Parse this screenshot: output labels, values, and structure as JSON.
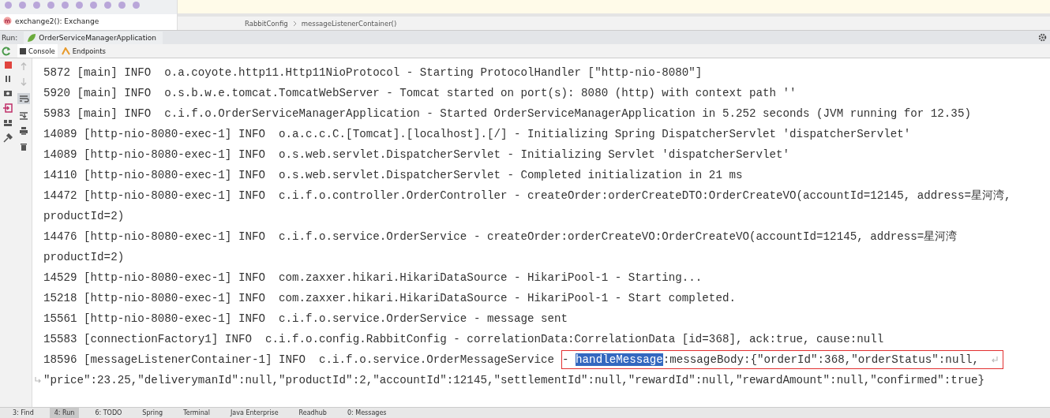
{
  "structure": {
    "item": "exchange2(): Exchange"
  },
  "breadcrumb": [
    "RabbitConfig",
    "messageListenerContainer()"
  ],
  "run_bar": {
    "label": "Run:",
    "tab": "OrderServiceManagerApplication"
  },
  "console_tabs": [
    {
      "label": "Console",
      "selected": true
    },
    {
      "label": "Endpoints",
      "selected": false
    }
  ],
  "log_lines": [
    {
      "kind": "plain",
      "text": "5872 [main] INFO  o.a.coyote.http11.Http11NioProtocol - Starting ProtocolHandler [\"http-nio-8080\"]"
    },
    {
      "kind": "plain",
      "text": "5920 [main] INFO  o.s.b.w.e.tomcat.TomcatWebServer - Tomcat started on port(s): 8080 (http) with context path ''"
    },
    {
      "kind": "plain",
      "text": "5983 [main] INFO  c.i.f.o.OrderServiceManagerApplication - Started OrderServiceManagerApplication in 5.252 seconds (JVM running for 12.35)"
    },
    {
      "kind": "plain",
      "text": "14089 [http-nio-8080-exec-1] INFO  o.a.c.c.C.[Tomcat].[localhost].[/] - Initializing Spring DispatcherServlet 'dispatcherServlet'"
    },
    {
      "kind": "plain",
      "text": "14089 [http-nio-8080-exec-1] INFO  o.s.web.servlet.DispatcherServlet - Initializing Servlet 'dispatcherServlet'"
    },
    {
      "kind": "plain",
      "text": "14110 [http-nio-8080-exec-1] INFO  o.s.web.servlet.DispatcherServlet - Completed initialization in 21 ms"
    },
    {
      "kind": "plain",
      "text": "14472 [http-nio-8080-exec-1] INFO  c.i.f.o.controller.OrderController - createOrder:orderCreateDTO:OrderCreateVO(accountId=12145, address=星河湾,",
      "continuation": "productId=2)"
    },
    {
      "kind": "plain",
      "text": "14476 [http-nio-8080-exec-1] INFO  c.i.f.o.service.OrderService - createOrder:orderCreateVO:OrderCreateVO(accountId=12145, address=星河湾",
      "continuation": "productId=2)"
    },
    {
      "kind": "plain",
      "text": "14529 [http-nio-8080-exec-1] INFO  com.zaxxer.hikari.HikariDataSource - HikariPool-1 - Starting..."
    },
    {
      "kind": "plain",
      "text": "15218 [http-nio-8080-exec-1] INFO  com.zaxxer.hikari.HikariDataSource - HikariPool-1 - Start completed."
    },
    {
      "kind": "plain",
      "text": "15561 [http-nio-8080-exec-1] INFO  c.i.f.o.service.OrderService - message sent"
    },
    {
      "kind": "plain",
      "text": "15583 [connectionFactory1] INFO  c.i.f.o.config.RabbitConfig - correlationData:CorrelationData [id=368], ack:true, cause:null"
    },
    {
      "kind": "highlighted",
      "text": "18596 [messageListenerContainer-1] INFO  c.i.f.o.service.OrderMessageService",
      "boxed": "- ",
      "selected": "handleMessage",
      "rest": ":messageBody:{\"orderId\":368,\"orderStatus\":null,",
      "continuation": "\"price\":23.25,\"deliverymanId\":null,\"productId\":2,\"accountId\":12145,\"settlementId\":null,\"rewardId\":null,\"rewardAmount\":null,\"confirmed\":true}"
    }
  ],
  "bottom_tools": [
    {
      "label": "3: Find",
      "selected": false
    },
    {
      "label": "4: Run",
      "selected": true
    },
    {
      "label": "6: TODO",
      "selected": false
    },
    {
      "label": "Spring",
      "selected": false
    },
    {
      "label": "Terminal",
      "selected": false
    },
    {
      "label": "Java Enterprise",
      "selected": false
    },
    {
      "label": "Readhub",
      "selected": false
    },
    {
      "label": "0: Messages",
      "selected": false
    }
  ]
}
